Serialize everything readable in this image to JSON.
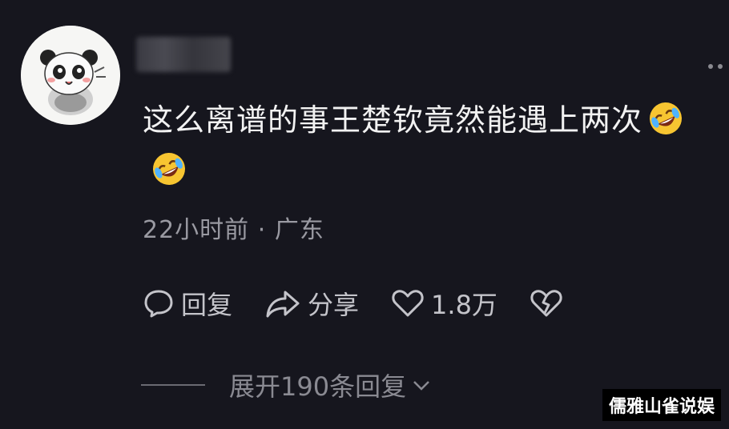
{
  "comment": {
    "text": "这么离谱的事王楚钦竟然能遇上两次",
    "emoji": "rolling-on-floor-laughing-emoji"
  },
  "meta": {
    "time": "22小时前",
    "separator": "·",
    "location": "广东"
  },
  "actions": {
    "reply": "回复",
    "share": "分享",
    "likes": "1.8万"
  },
  "expand": {
    "label": "展开190条回复"
  },
  "watermark": "儒雅山雀说娱",
  "icons": [
    "avatar-panda",
    "more-icon",
    "reply-icon",
    "share-icon",
    "heart-icon",
    "broken-heart-icon",
    "chevron-down-icon"
  ],
  "colors": {
    "background": "#16161e",
    "text": "#f2f2f2",
    "muted": "#9a9aa2"
  }
}
